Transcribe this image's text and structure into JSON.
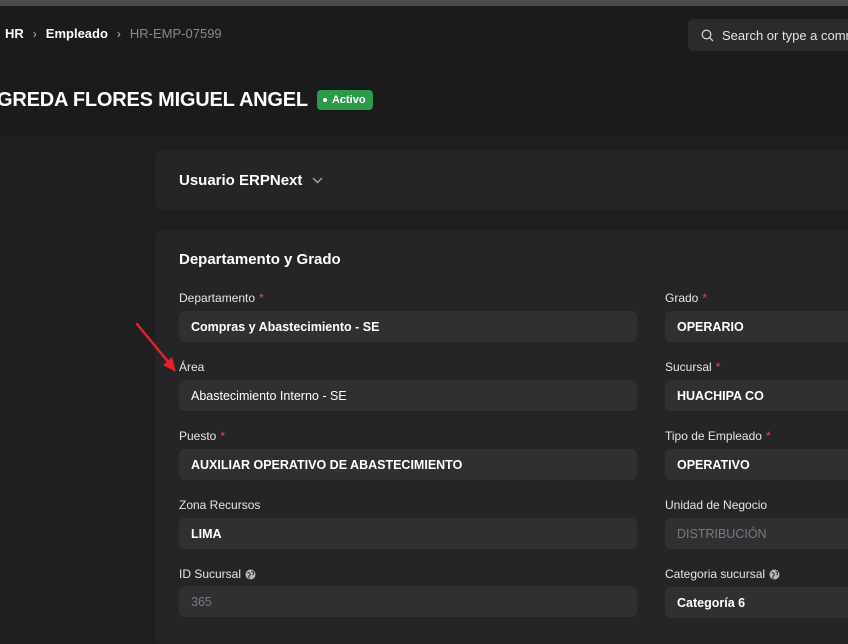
{
  "breadcrumbs": [
    "HR",
    "Empleado",
    "HR-EMP-07599"
  ],
  "search": {
    "placeholder": "Search or type a command"
  },
  "page": {
    "title": "GREDA FLORES MIGUEL ANGEL",
    "status": "Activo"
  },
  "sections": {
    "usuario": {
      "title": "Usuario ERPNext"
    },
    "departamento": {
      "title": "Departamento y Grado"
    }
  },
  "fields": {
    "departamento": {
      "label": "Departamento",
      "value": "Compras y Abastecimiento - SE"
    },
    "grado": {
      "label": "Grado",
      "value": "OPERARIO"
    },
    "area": {
      "label": "Área",
      "value": "Abastecimiento Interno - SE"
    },
    "sucursal": {
      "label": "Sucursal",
      "value": "HUACHIPA CO"
    },
    "puesto": {
      "label": "Puesto",
      "value": "AUXILIAR OPERATIVO DE ABASTECIMIENTO"
    },
    "tipo_empleado": {
      "label": "Tipo de Empleado",
      "value": "OPERATIVO"
    },
    "zona_recursos": {
      "label": "Zona Recursos",
      "value": "LIMA"
    },
    "unidad_negocio": {
      "label": "Unidad de Negocio",
      "value": "DISTRIBUCIÓN"
    },
    "id_sucursal": {
      "label": "ID Sucursal",
      "value": "365"
    },
    "categoria_sucursal": {
      "label": "Categoria sucursal",
      "value": "Categoría 6"
    }
  },
  "colors": {
    "status_green": "#2c9a4a",
    "required_red": "#e5484d",
    "arrow_red": "#e8202a"
  },
  "icons": [
    "search-icon",
    "chevron-down-icon",
    "globe-icon",
    "arrow-annotation"
  ]
}
